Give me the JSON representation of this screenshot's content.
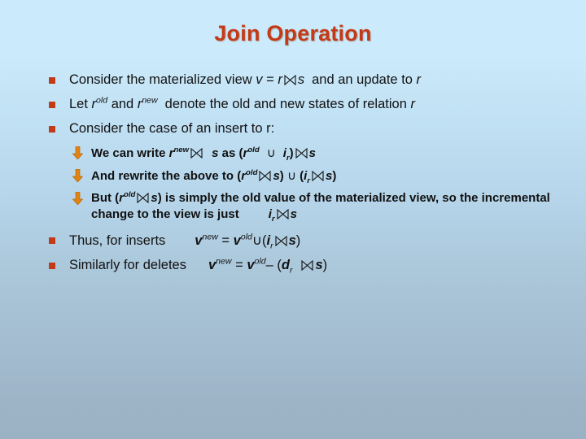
{
  "slide": {
    "title": "Join Operation",
    "background_top_color": "#cbeafb",
    "background_bottom_color": "#9bb2c5",
    "title_color": "#c43a17",
    "bullet_square_color": "#c33a18",
    "bullet_arrow_color": "#e08214",
    "text_color": "#111111"
  },
  "bullets": [
    {
      "level": 1,
      "marker": "square-bullet",
      "text": "Consider the materialized view v = r ⋈ s  and an update to r"
    },
    {
      "level": 1,
      "marker": "square-bullet",
      "text": "Let rold and rnew denote the old and new states of relation r"
    },
    {
      "level": 1,
      "marker": "square-bullet",
      "text": "Consider the case of an insert to r:"
    },
    {
      "level": 2,
      "marker": "arrow-bullet",
      "text": "We can write rnew ⋈ s as (rold ∪ ir) ⋈ s"
    },
    {
      "level": 2,
      "marker": "arrow-bullet",
      "text": "And rewrite the above to  (rold ⋈ s) ∪ (ir ⋈ s)"
    },
    {
      "level": 2,
      "marker": "arrow-bullet",
      "text": "But (rold ⋈ s) is simply the old value of the materialized view, so the incremental change to the view is just    ir ⋈ s"
    },
    {
      "level": 1,
      "marker": "square-bullet",
      "text": "Thus, for inserts     vnew = vold ∪ (ir ⋈ s)"
    },
    {
      "level": 1,
      "marker": "square-bullet",
      "text": "Similarly for deletes    vnew = vold – (dr ⋈ s)"
    }
  ],
  "fragments": {
    "b1_pre": "Consider the materialized view ",
    "b1_v": "v",
    "b1_eq": " = ",
    "b1_r": "r",
    "b1_s": "s",
    "b1_post": "and an update to ",
    "b1_r2": "r",
    "b2_let": "Let ",
    "b2_r1": "r",
    "b2_old": "old",
    "b2_and": " and ",
    "b2_r2": "r",
    "b2_new": "new",
    "b2_post": "denote the old and new states of relation ",
    "b2_r3": "r",
    "b3_text": "Consider the case of an insert to r:",
    "s1_pre": "We can write ",
    "s1_r": "r",
    "s1_new": "new",
    "s1_s1": "s",
    "s1_as": " as (",
    "s1_r2": "r",
    "s1_old": "old",
    "s1_union": "∪",
    "s1_i": "i",
    "s1_ir": "r",
    "s1_close": ")",
    "s1_s2": "s",
    "s2_pre": "And rewrite the above to  (",
    "s2_r": "r",
    "s2_old": "old",
    "s2_s1": "s",
    "s2_mid": ") ",
    "s2_union": "∪",
    "s2_open": " (",
    "s2_i": "i",
    "s2_ir": "r",
    "s2_s2": "s",
    "s2_close": ")",
    "s3_pre": "But (",
    "s3_r": "r",
    "s3_old": "old",
    "s3_s": "s",
    "s3_mid": ") is simply the old value of the materialized view, so the",
    "s3_line2": "incremental change to the view is just",
    "s3_i": "i",
    "s3_ir": "r",
    "s3_s2": "s",
    "b4_label": "Thus, for inserts",
    "b4_v1": "v",
    "b4_new": "new",
    "b4_eq": " = ",
    "b4_v2": "v",
    "b4_old": "old",
    "b4_union": "∪",
    "b4_open": "(",
    "b4_i": "i",
    "b4_ir": "r",
    "b4_s": "s",
    "b4_close": ")",
    "b5_label": "Similarly for deletes",
    "b5_v1": "v",
    "b5_new": "new",
    "b5_eq": " = ",
    "b5_v2": "v",
    "b5_old": "old",
    "b5_minus": "– (",
    "b5_d": "d",
    "b5_dr": "r",
    "b5_s": "s",
    "b5_close": ")"
  }
}
